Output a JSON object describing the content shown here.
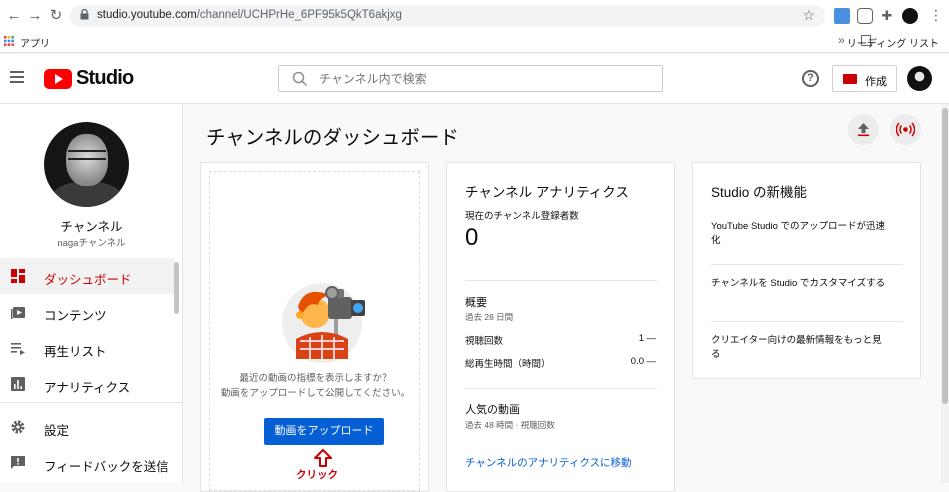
{
  "browser": {
    "url_host": "studio.youtube.com",
    "url_path": "/channel/UCHPrHe_6PF95k5QkT6akjxg",
    "bookmarks_apps": "アプリ",
    "reading_list": "リーディング リスト",
    "bookmarks_more": "»"
  },
  "header": {
    "logo_text": "Studio",
    "search_placeholder": "チャンネル内で検索",
    "create_label": "作成"
  },
  "sidebar": {
    "channel_name": "チャンネル",
    "channel_handle": "nagaチャンネル",
    "items": [
      {
        "label": "ダッシュボード",
        "icon": "dashboard-icon",
        "active": true
      },
      {
        "label": "コンテンツ",
        "icon": "content-icon"
      },
      {
        "label": "再生リスト",
        "icon": "playlist-icon"
      },
      {
        "label": "アナリティクス",
        "icon": "analytics-icon"
      },
      {
        "label": "設定",
        "icon": "settings-icon"
      },
      {
        "label": "フィードバックを送信",
        "icon": "feedback-icon"
      }
    ]
  },
  "main": {
    "title": "チャンネルのダッシュボード",
    "upload_card": {
      "text_line1": "最近の動画の指標を表示しますか？",
      "text_line2": "動画をアップロードして公開してください。",
      "button_label": "動画をアップロード",
      "click_annotation": "クリック"
    },
    "analytics_card": {
      "title": "チャンネル アナリティクス",
      "subs_label": "現在のチャンネル登録者数",
      "subs_value": "0",
      "summary_title": "概要",
      "summary_period": "過去 28 日間",
      "rows": [
        {
          "label": "視聴回数",
          "value": "1",
          "trend": "—"
        },
        {
          "label": "総再生時間（時間）",
          "value": "0.0",
          "trend": "—"
        }
      ],
      "popular_title": "人気の動画",
      "popular_period": "過去 48 時間 · 視聴回数",
      "link_label": "チャンネルのアナリティクスに移動"
    },
    "news_card": {
      "title": "Studio の新機能",
      "items": [
        "YouTube Studio でのアップロードが迅速化",
        "チャンネルを Studio でカスタマイズする",
        "クリエイター向けの最新情報をもっと見る"
      ]
    }
  },
  "colors": {
    "accent_red": "#cc0000",
    "youtube_red": "#ff0000",
    "link_blue": "#065fd4"
  }
}
